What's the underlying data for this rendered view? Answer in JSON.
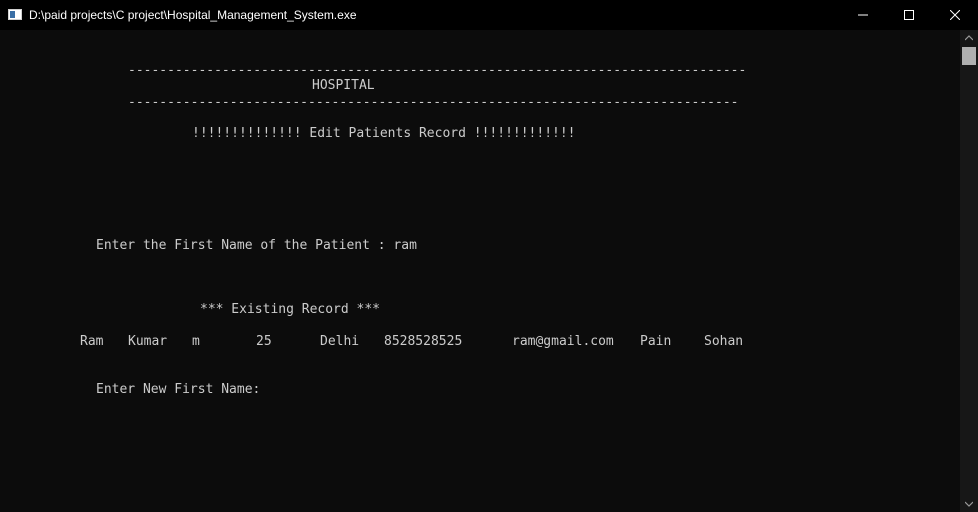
{
  "window": {
    "title": "D:\\paid projects\\C project\\Hospital_Management_System.exe",
    "icon": "console-window-icon",
    "controls": [
      "minimize-icon",
      "maximize-icon",
      "close-icon"
    ]
  },
  "console": {
    "divider_top": "-------------------------------------------------------------------------------",
    "heading": "HOSPITAL",
    "divider_bottom": "------------------------------------------------------------------------------",
    "subheading": "!!!!!!!!!!!!!! Edit Patients Record !!!!!!!!!!!!!",
    "prompt_first_name": "Enter the First Name of the Patient : ram",
    "existing_record_label": "*** Existing Record ***",
    "record": {
      "first_name": "Ram",
      "last_name": "Kumar",
      "gender": "m",
      "age": "25",
      "city": "Delhi",
      "phone": "8528528525",
      "email": "ram@gmail.com",
      "problem": "Pain",
      "doctor": "Sohan"
    },
    "prompt_new_first_name": "Enter New First Name:"
  },
  "colors": {
    "background": "#0c0c0c",
    "text": "#cccccc",
    "titlebar": "#000000"
  }
}
